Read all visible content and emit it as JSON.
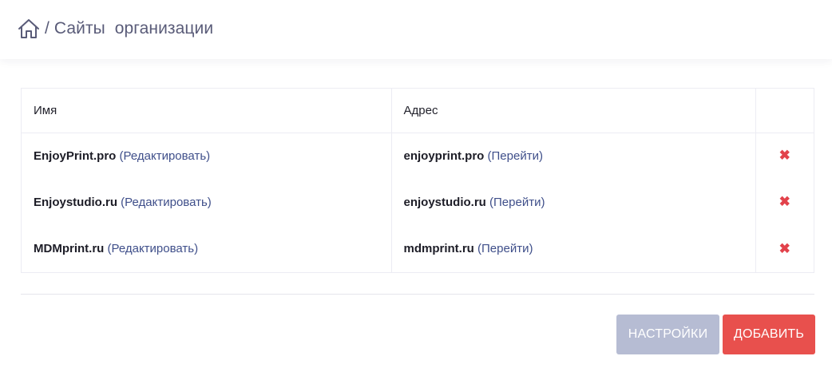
{
  "header": {
    "separator": "/",
    "title": "Сайты  организации"
  },
  "table": {
    "columns": [
      "Имя",
      "Адрес",
      ""
    ],
    "rows": [
      {
        "name": "EnjoyPrint.pro",
        "edit_label": "Редактировать",
        "address": "enjoyprint.pro",
        "go_label": "Перейти"
      },
      {
        "name": "Enjoystudio.ru",
        "edit_label": "Редактировать",
        "address": "enjoystudio.ru",
        "go_label": "Перейти"
      },
      {
        "name": "MDMprint.ru",
        "edit_label": "Редактировать",
        "address": "mdmprint.ru",
        "go_label": "Перейти"
      }
    ],
    "delete_icon": "close-icon"
  },
  "buttons": {
    "settings_label": "НАСТРОЙКИ",
    "add_label": "ДОБАВИТЬ"
  },
  "colors": {
    "link": "#3f4f8a",
    "delete": "#e2424b",
    "settings_button": "#b6bcd3",
    "add_button": "#e8504d",
    "breadcrumb_text": "#595b78"
  }
}
